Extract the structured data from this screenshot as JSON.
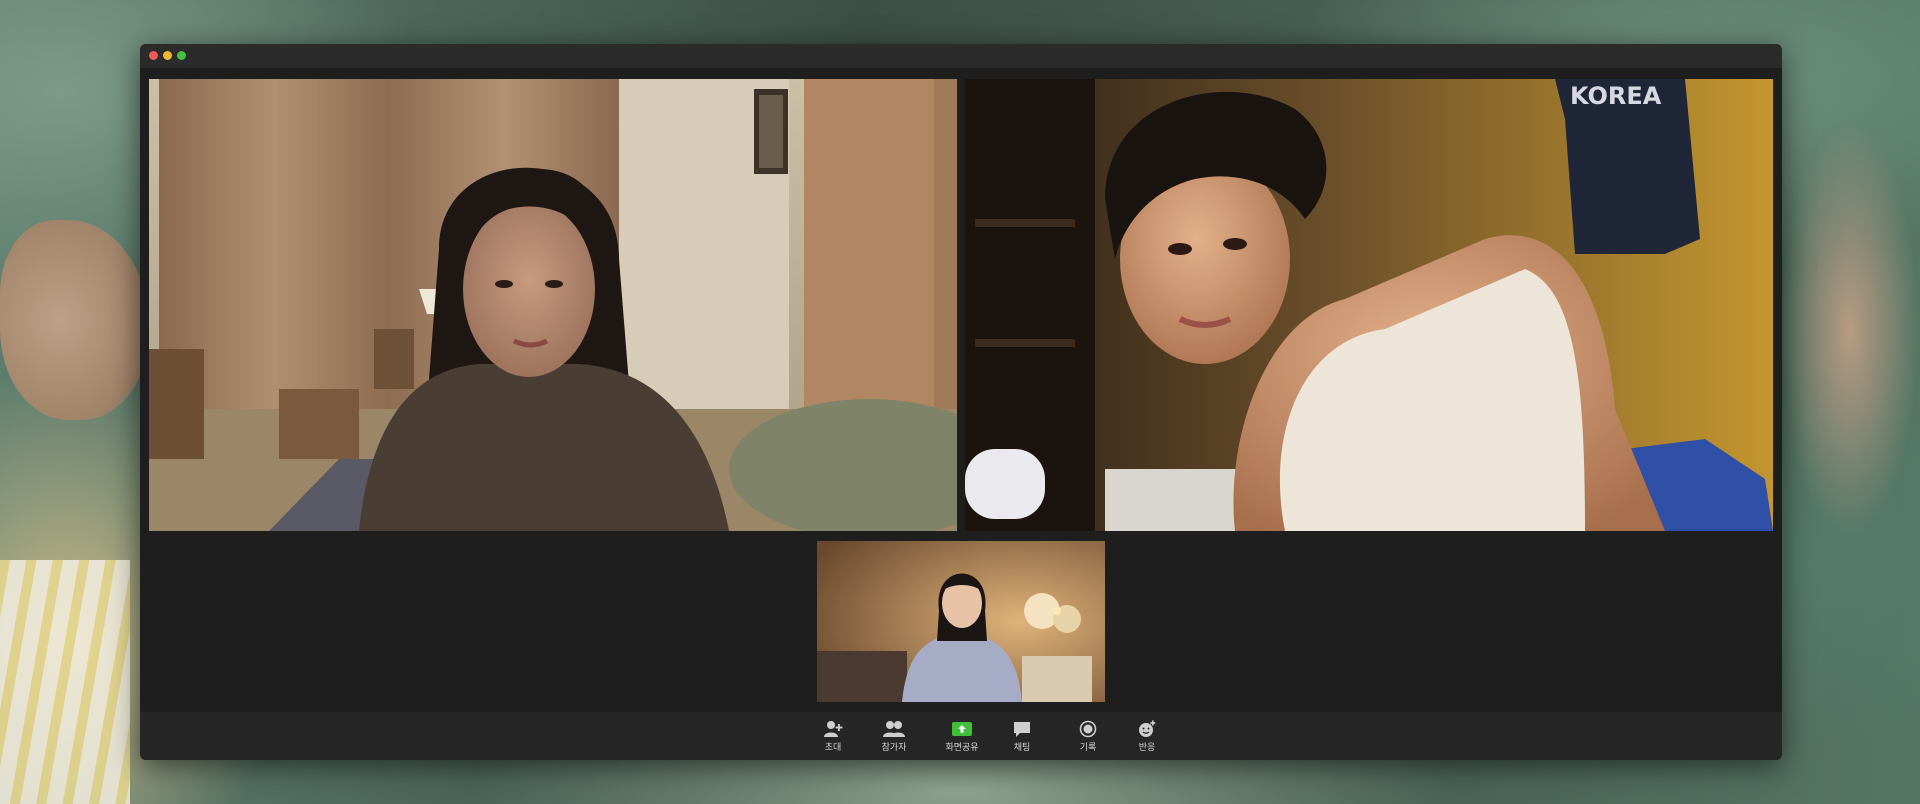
{
  "window": {
    "traffic_lights": [
      "close",
      "minimize",
      "zoom"
    ],
    "colors": {
      "close": "#ee5b55",
      "minimize": "#f1b830",
      "zoom": "#41c143",
      "share_accent": "#3fbf3a"
    }
  },
  "participants": [
    {
      "id": "tile-1",
      "scene": "young woman with long dark hair in a beige-curtained bedroom"
    },
    {
      "id": "tile-2",
      "scene": "young man in white tank top leaning toward camera, KOREA jersey on wall"
    },
    {
      "id": "tile-3",
      "scene": "young woman in light blue collared dress, warm lit room"
    }
  ],
  "jersey_text": "KOREA",
  "toolbar": {
    "invite": {
      "label": "초대",
      "icon": "add-person-icon"
    },
    "participants": {
      "label": "참가자",
      "icon": "participants-icon"
    },
    "share_screen": {
      "label": "화면공유",
      "icon": "share-screen-icon"
    },
    "chat": {
      "label": "채팅",
      "icon": "chat-bubble-icon"
    },
    "record": {
      "label": "기록",
      "icon": "record-icon"
    },
    "reactions": {
      "label": "반응",
      "icon": "reaction-icon"
    }
  }
}
